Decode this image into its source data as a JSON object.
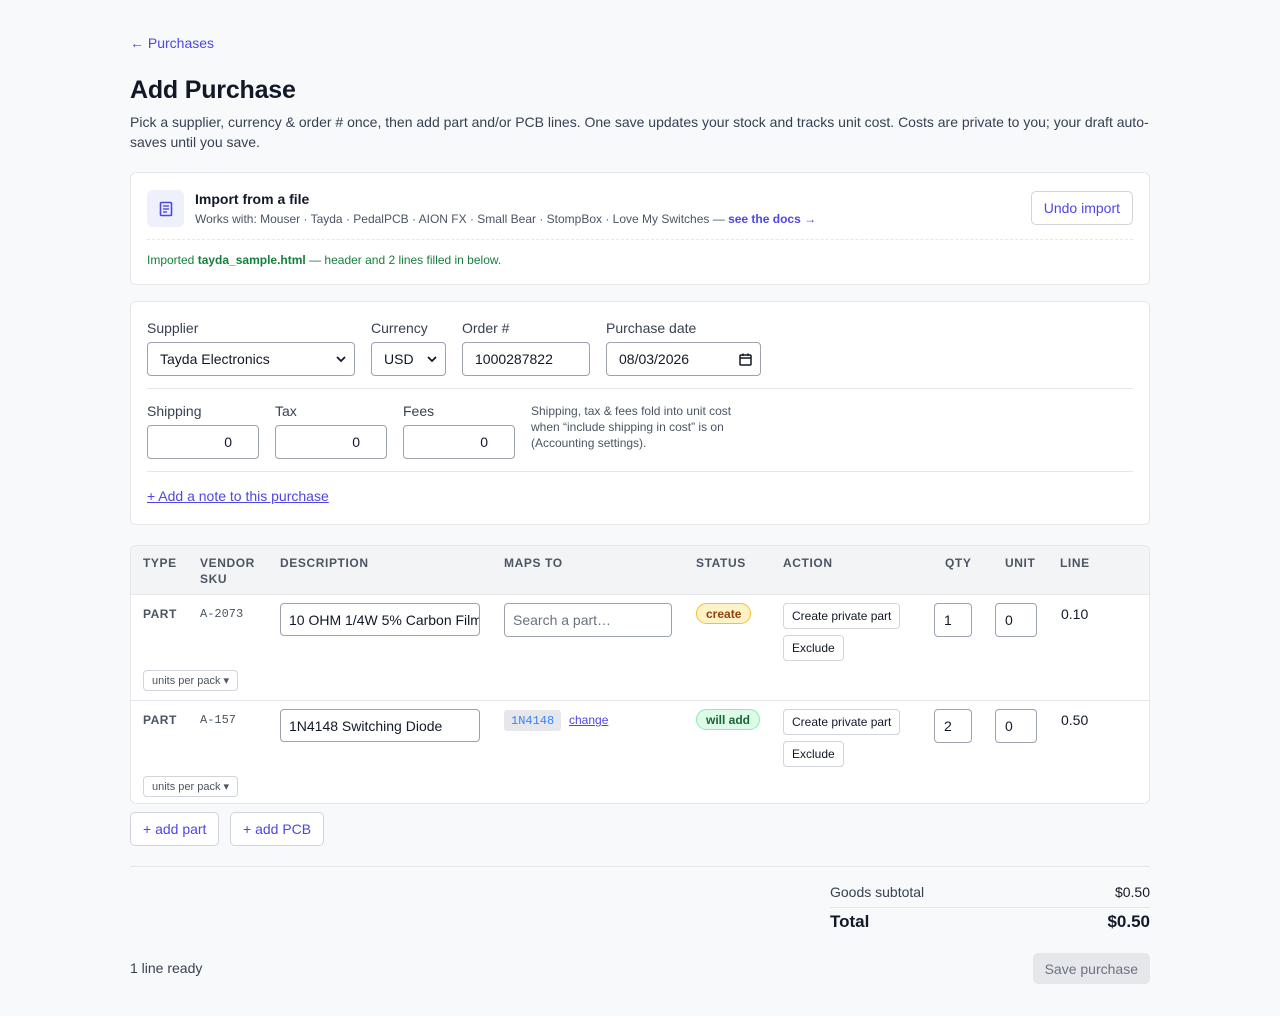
{
  "nav": {
    "back_label": "← Purchases"
  },
  "page": {
    "title": "Add Purchase",
    "intro": "Pick a supplier, currency & order # once, then add part and/or PCB lines. One save updates your stock and tracks unit cost. Costs are private to you; your draft auto-saves until you save."
  },
  "import": {
    "title": "Import from a file",
    "works_with": "Works with: Mouser · Tayda · PedalPCB · AION FX · Small Bear · StompBox · Love My Switches — ",
    "docs_link": "see the docs →",
    "undo_label": "Undo import",
    "result_prefix": "Imported ",
    "result_file": "tayda_sample.html",
    "result_suffix": " — header and 2 lines filled in below."
  },
  "header_form": {
    "supplier_label": "Supplier",
    "supplier_value": "Tayda Electronics",
    "currency_label": "Currency",
    "currency_value": "USD",
    "order_label": "Order #",
    "order_value": "1000287822",
    "date_label": "Purchase date",
    "date_value": "08/03/2026",
    "shipping_label": "Shipping",
    "shipping_value": "0",
    "tax_label": "Tax",
    "tax_value": "0",
    "fees_label": "Fees",
    "fees_value": "0",
    "hint": "Shipping, tax & fees fold into unit cost when “include shipping in cost” is on (Accounting settings).",
    "note_link": "+ Add a note to this purchase"
  },
  "table": {
    "columns": {
      "type": "TYPE",
      "vendor_sku": "VENDOR SKU",
      "description": "DESCRIPTION",
      "maps_to": "MAPS TO",
      "status": "STATUS",
      "action": "ACTION",
      "qty": "QTY",
      "unit": "UNIT",
      "line": "LINE"
    },
    "rows": [
      {
        "type": "PART",
        "sku": "A-2073",
        "description": "10 OHM 1/4W 5% Carbon Film",
        "maps_placeholder": "Search a part…",
        "status": "create",
        "create_label": "Create private part",
        "exclude_label": "Exclude",
        "qty": "1",
        "unit": "0",
        "line": "0.10",
        "upp_label": "units per pack ▾"
      },
      {
        "type": "PART",
        "sku": "A-157",
        "description": "1N4148 Switching Diode",
        "maps_tag": "1N4148",
        "maps_change": "change",
        "status": "will add",
        "create_label": "Create private part",
        "exclude_label": "Exclude",
        "qty": "2",
        "unit": "0",
        "line": "0.50",
        "upp_label": "units per pack ▾"
      }
    ]
  },
  "actions": {
    "add_part": "+ add part",
    "add_pcb": "+ add PCB"
  },
  "totals": {
    "subtotal_label": "Goods subtotal",
    "subtotal_value": "$0.50",
    "total_label": "Total",
    "total_value": "$0.50"
  },
  "footer": {
    "ready": "1 line ready",
    "save_label": "Save purchase"
  },
  "icons": {
    "import": "receipt-icon",
    "select": "chevron-down-icon",
    "calendar": "calendar-icon"
  },
  "colors": {
    "accent": "#4f46e5",
    "success": "#15803d",
    "warning_badge": "#fef3c7",
    "success_badge": "#dcfce7"
  }
}
